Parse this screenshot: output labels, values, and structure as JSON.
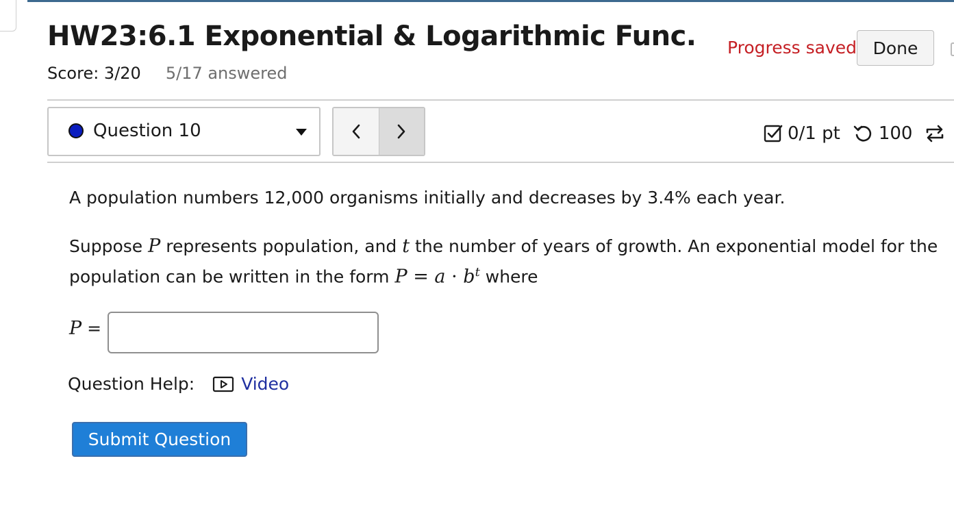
{
  "assignment": {
    "title": "HW23:6.1 Exponential & Logarithmic Func.",
    "score": "Score: 3/20",
    "answered": "5/17 answered",
    "progress_status": "Progress saved",
    "done_label": "Done"
  },
  "question_nav": {
    "selected": "Question 10",
    "status_color": "#0a1dbf",
    "prev_icon": "chevron-left-icon",
    "next_icon": "chevron-right-icon"
  },
  "points": {
    "score": "0/1 pt",
    "attempts": "100",
    "icons": [
      "checkbox-icon",
      "retry-icon",
      "reshuffle-icon"
    ]
  },
  "question": {
    "line1": "A population numbers 12,000 organisms initially and decreases by 3.4% each year.",
    "para2_a": "Suppose ",
    "var_P": "P",
    "para2_b": " represents population, and ",
    "var_t": "t",
    "para2_c": " the number of years of growth. An exponential model for the population can be written in the form ",
    "eq_P": "P",
    "eq_eq": " = ",
    "eq_a": "a",
    "eq_dot": " · ",
    "eq_b": "b",
    "eq_t": "t",
    "para2_d": " where",
    "answer_var": "P",
    "answer_eq": " =",
    "answer_value": ""
  },
  "help": {
    "label": "Question Help:",
    "video_label": "Video"
  },
  "submit_label": "Submit Question",
  "colors": {
    "accent": "#1f7fd7",
    "progress_saved": "#c51f24",
    "link": "#1f2fa0",
    "top_bar": "#3d6a8f"
  }
}
